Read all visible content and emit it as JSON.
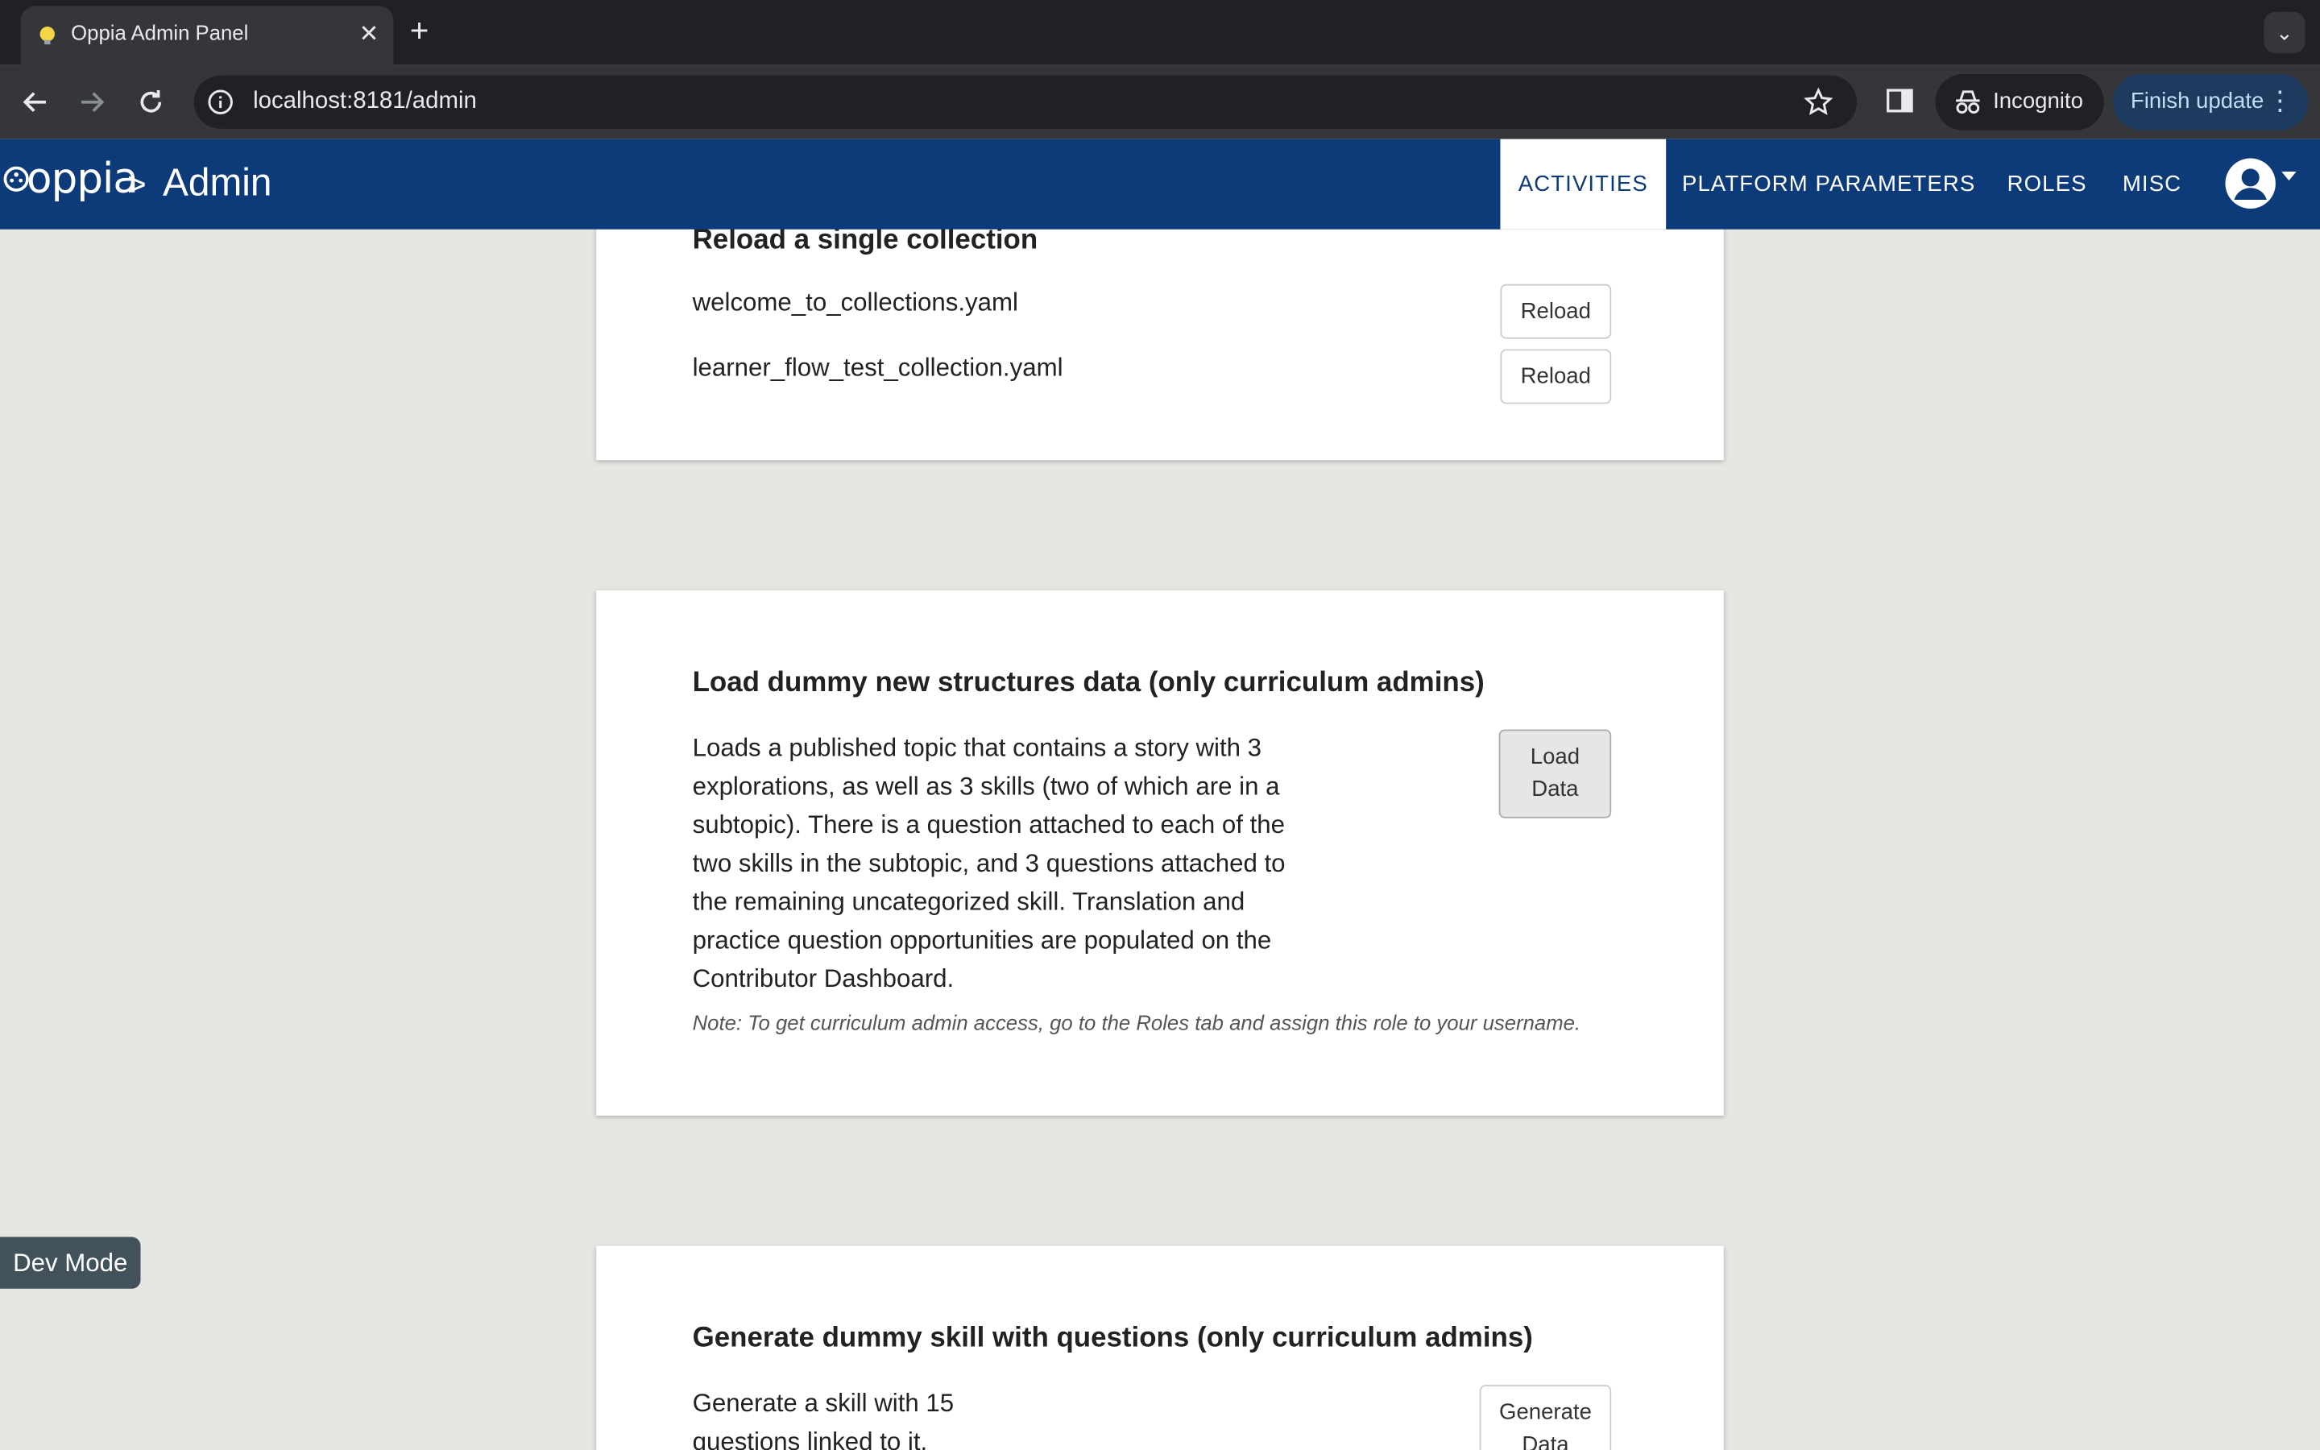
{
  "browser": {
    "tab_title": "Oppia Admin Panel",
    "url": "localhost:8181/admin",
    "incognito_label": "Incognito",
    "finish_update_label": "Finish update"
  },
  "header": {
    "logo_text": "oppia",
    "breadcrumb_separator": ">",
    "breadcrumb_page": "Admin",
    "tabs": [
      {
        "label": "ACTIVITIES",
        "active": true
      },
      {
        "label": "PLATFORM PARAMETERS",
        "active": false
      },
      {
        "label": "ROLES",
        "active": false
      },
      {
        "label": "MISC",
        "active": false
      }
    ]
  },
  "reload_collection": {
    "title": "Reload a single collection",
    "items": [
      {
        "file": "welcome_to_collections.yaml",
        "button": "Reload"
      },
      {
        "file": "learner_flow_test_collection.yaml",
        "button": "Reload"
      }
    ]
  },
  "dummy_structures": {
    "title": "Load dummy new structures data (only curriculum admins)",
    "description": "Loads a published topic that contains a story with 3 explorations, as well as 3 skills (two of which are in a subtopic). There is a question attached to each of the two skills in the subtopic, and 3 questions attached to the remaining uncategorized skill. Translation and practice question opportunities are populated on the Contributor Dashboard.",
    "note": "Note: To get curriculum admin access, go to the Roles tab and assign this role to your username.",
    "button_line1": "Load",
    "button_line2": "Data"
  },
  "dummy_skill": {
    "title": "Generate dummy skill with questions (only curriculum admins)",
    "description": "Generate a skill with 15 questions linked to it.",
    "button_line1": "Generate",
    "button_line2": "Data"
  },
  "dev_mode_label": "Dev Mode",
  "colors": {
    "header_bg": "#0d3b7a",
    "page_bg": "#e7e6e3",
    "dev_mode_bg": "#42525a"
  }
}
